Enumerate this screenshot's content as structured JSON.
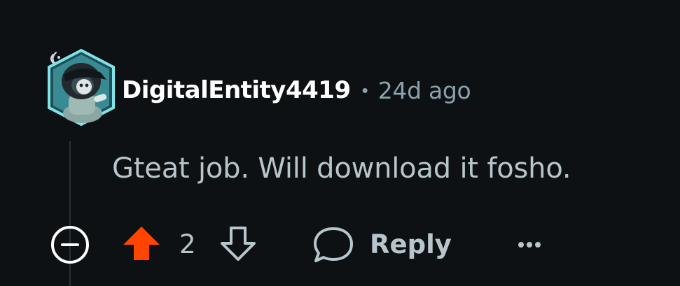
{
  "comment": {
    "author": "DigitalEntity4419",
    "separator": "•",
    "timestamp": "24d ago",
    "body": "Gteat job. Will download it fosho.",
    "score": "2",
    "reply_label": "Reply",
    "upvoted": true
  },
  "colors": {
    "background": "#0e1113",
    "username": "#ffffff",
    "muted_text": "#8ba2ad",
    "body_text": "#b7c5cc",
    "upvote_active": "#ff4500",
    "avatar_ring": "#7fe3e8"
  },
  "icons": {
    "collapse": "minus-circle-icon",
    "upvote": "arrow-up-icon",
    "downvote": "arrow-down-icon",
    "reply": "speech-bubble-icon",
    "more": "ellipsis-icon",
    "avatar_badge": "signal-icon"
  }
}
